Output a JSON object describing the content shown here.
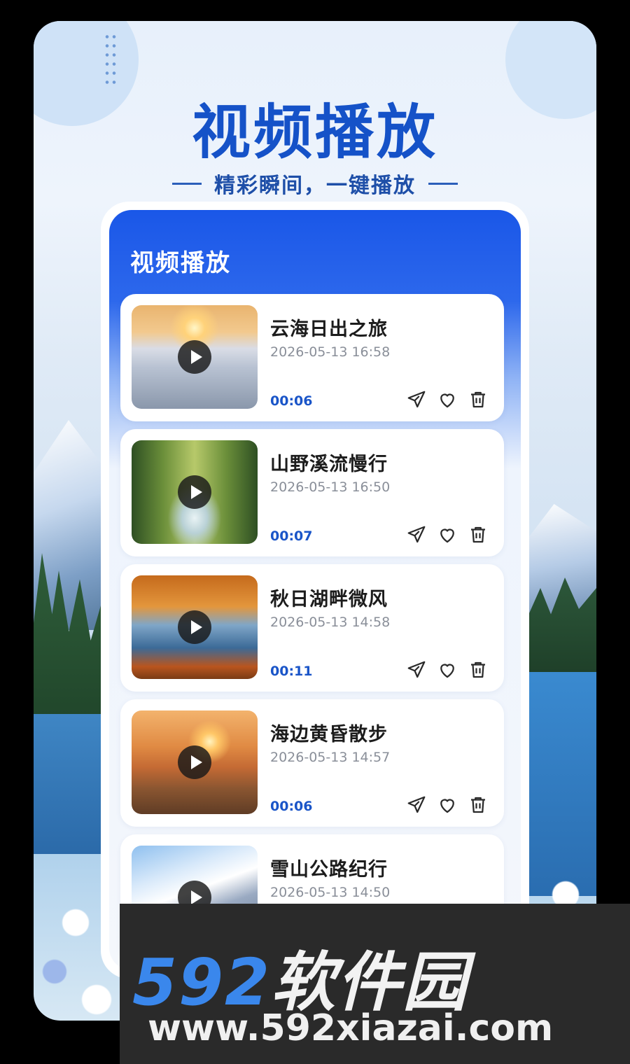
{
  "hero": {
    "title": "视频播放",
    "subtitle": "精彩瞬间，一键播放"
  },
  "card": {
    "title": "视频播放"
  },
  "videos": [
    {
      "title": "云海日出之旅",
      "date": "2026-05-13 16:58",
      "duration": "00:06",
      "thumb": "sunrise-over-clouds"
    },
    {
      "title": "山野溪流慢行",
      "date": "2026-05-13 16:50",
      "duration": "00:07",
      "thumb": "forest-stream"
    },
    {
      "title": "秋日湖畔微风",
      "date": "2026-05-13 14:58",
      "duration": "00:11",
      "thumb": "autumn-lakeside"
    },
    {
      "title": "海边黄昏散步",
      "date": "2026-05-13 14:57",
      "duration": "00:06",
      "thumb": "beach-sunset"
    },
    {
      "title": "雪山公路纪行",
      "date": "2026-05-13 14:50",
      "duration": "",
      "thumb": "snow-mountains"
    }
  ],
  "icons": [
    "send-icon",
    "heart-icon",
    "trash-icon",
    "play-icon"
  ],
  "colors": {
    "accent": "#1552c8",
    "header_blue": "#1a57e8",
    "duration": "#1a55c8",
    "watermark_number": "#3a87ec"
  },
  "watermark": {
    "number": "592",
    "name": "软件园",
    "url": "www.592xiazai.com"
  }
}
